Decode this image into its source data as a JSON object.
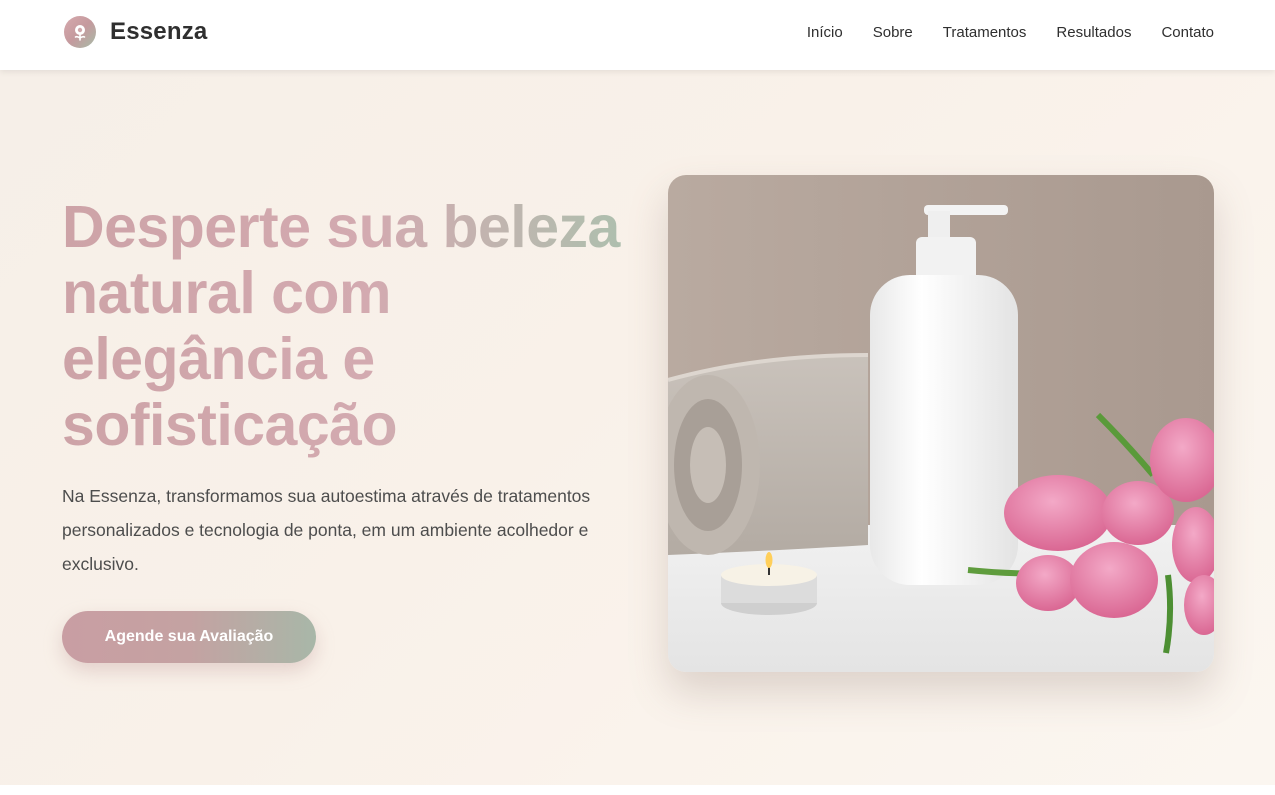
{
  "header": {
    "brand_name": "Essenza",
    "logo_icon": "flower-logo-icon",
    "nav": [
      {
        "label": "Início"
      },
      {
        "label": "Sobre"
      },
      {
        "label": "Tratamentos"
      },
      {
        "label": "Resultados"
      },
      {
        "label": "Contato"
      }
    ]
  },
  "hero": {
    "title": "Desperte sua beleza natural com elegância e sofisticação",
    "description": "Na Essenza, transformamos sua autoestima através de tratamentos personalizados e tecnologia de ponta, em um ambiente acolhedor e exclusivo.",
    "cta_label": "Agende sua Avaliação",
    "image_subject": "spa-products-photo"
  },
  "colors": {
    "accent_rose": "#cda3a7",
    "accent_sage": "#aebfae",
    "background_cream": "#f8f0e8",
    "text_dark": "#2f2f2f"
  }
}
